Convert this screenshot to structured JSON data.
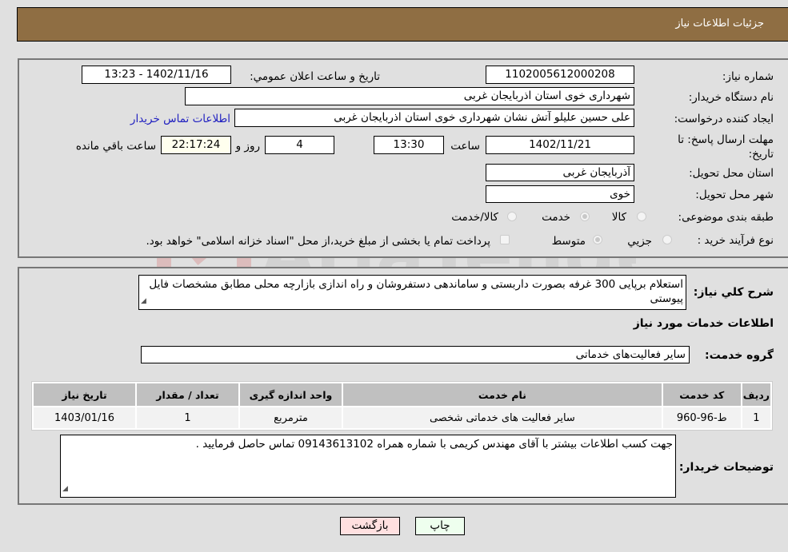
{
  "header": {
    "title": "جزئیات اطلاعات نیاز"
  },
  "info": {
    "need_number_label": "شماره نیاز:",
    "need_number": "1102005612000208",
    "announce_label": "تاریخ و ساعت اعلان عمومي:",
    "announce_value": "1402/11/16 - 13:23",
    "buyer_org_label": "نام دستگاه خریدار:",
    "buyer_org": "شهرداری خوی استان اذربایجان غربی",
    "creator_label": "ایجاد کننده درخواست:",
    "creator": "علی حسین علیلو آتش نشان شهرداری خوی استان اذربایجان غربی",
    "contact_link": "اطلاعات تماس خریدار",
    "deadline_label": "مهلت ارسال پاسخ: تا تاریخ:",
    "deadline_date": "1402/11/21",
    "time_label": "ساعت",
    "deadline_time": "13:30",
    "days": "4",
    "days_label": "روز و",
    "remaining": "22:17:24",
    "remaining_label": "ساعت باقي مانده",
    "province_label": "استان محل تحویل:",
    "province": "آذربایجان غربی",
    "city_label": "شهر محل تحویل:",
    "city": "خوی",
    "category_label": "طبقه بندی موضوعی:",
    "category_options": [
      {
        "label": "کالا",
        "checked": false
      },
      {
        "label": "خدمت",
        "checked": true
      },
      {
        "label": "کالا/خدمت",
        "checked": false
      }
    ],
    "process_label": "نوع فرآیند خرید :",
    "process_options": [
      {
        "label": "جزيي",
        "checked": false
      },
      {
        "label": "متوسط",
        "checked": true
      }
    ],
    "treasury_note": "پرداخت تمام یا بخشی از مبلغ خرید،از محل \"اسناد خزانه اسلامی\" خواهد بود.",
    "treasury_checked": false
  },
  "details": {
    "description_label": "شرح کلي نياز:",
    "description": "استعلام برپایی 300 غرفه بصورت داربستی و ساماندهی دستفروشان و راه اندازی بازارچه محلی مطابق مشخصات فایل پیوستی",
    "services_heading": "اطلاعات خدمات مورد نياز",
    "service_group_label": "گروه خدمت:",
    "service_group": "سایر فعالیت‌های خدماتی",
    "table": {
      "headers": [
        "ردیف",
        "کد خدمت",
        "نام خدمت",
        "واحد اندازه گیری",
        "تعداد / مقدار",
        "تاریخ نیاز"
      ],
      "rows": [
        [
          "1",
          "ط-96-960",
          "سایر فعالیت های خدماتی شخصی",
          "مترمربع",
          "1",
          "1403/01/16"
        ]
      ]
    },
    "buyer_notes_label": "توضیحات خریدار:",
    "buyer_notes": "جهت کسب اطلاعات بیشتر با آقای مهندس کریمی با شماره همراه 09143613102 تماس حاصل فرمایید ."
  },
  "buttons": {
    "print": "چاپ",
    "back": "بازگشت"
  },
  "colors": {
    "header_bg": "#8f6e43",
    "print_bg": "#eeffee",
    "back_bg": "#ffe0e0",
    "link": "#2020c0"
  }
}
